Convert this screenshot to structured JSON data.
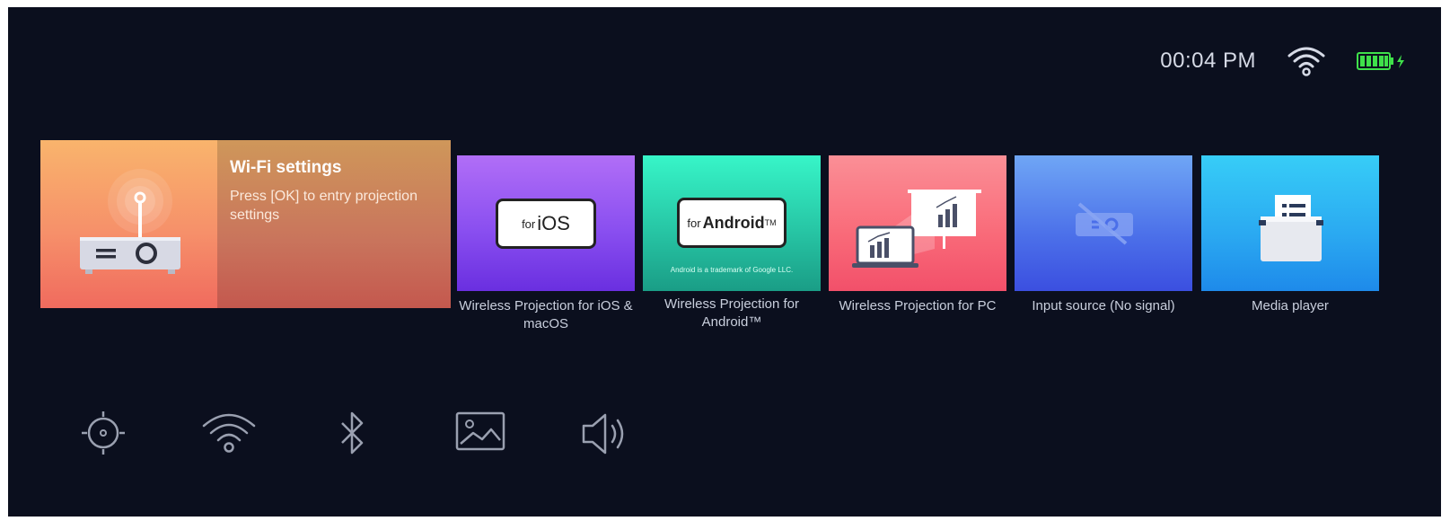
{
  "status": {
    "time": "00:04 PM",
    "wifi_icon": "wifi-icon",
    "battery_icon": "battery-charging-icon"
  },
  "tiles": {
    "wifi": {
      "title": "Wi-Fi settings",
      "description": "Press [OK] to entry projection settings",
      "icon": "projector-icon"
    },
    "ios": {
      "badge_prefix": "for",
      "badge": "iOS",
      "caption": "Wireless Projection for iOS & macOS"
    },
    "android": {
      "badge_prefix": "for",
      "badge": "Android",
      "badge_tm": "TM",
      "trademark": "Android is a trademark of Google LLC.",
      "caption": "Wireless Projection for Android™"
    },
    "pc": {
      "caption": "Wireless Projection for PC",
      "icon": "laptop-presentation-icon"
    },
    "input": {
      "caption": "Input source (No signal)",
      "icon": "no-signal-icon"
    },
    "media": {
      "caption": "Media player",
      "icon": "folder-icon"
    }
  },
  "bottom_bar": [
    "brightness-icon",
    "wifi-icon",
    "bluetooth-icon",
    "image-icon",
    "volume-icon"
  ],
  "colors": {
    "background": "#0b0f1e",
    "text": "#c9cfdd",
    "battery": "#3fe04a"
  }
}
